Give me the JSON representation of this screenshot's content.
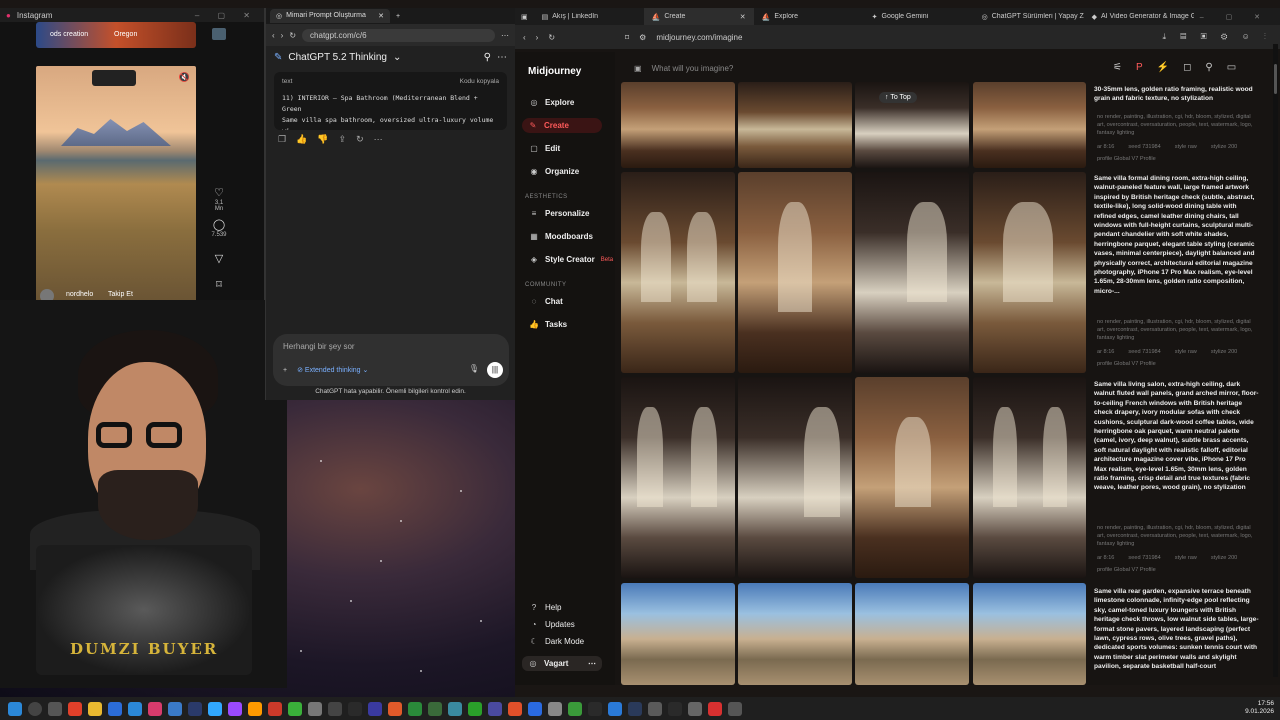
{
  "instagram": {
    "window_title": "Instagram",
    "banner_left": "ods creation",
    "banner_right": "Oregon",
    "handle": "nordhelo",
    "follow": "Takip Et",
    "likes": "3,1 Mn",
    "comments": "7.539"
  },
  "chatgpt": {
    "tab_title": "Mimari Prompt Oluşturma",
    "url": "chatgpt.com/c/6",
    "model": "ChatGPT 5.2 Thinking",
    "code_lang": "text",
    "copy_label": "Kodu kopyala",
    "code_line1": "11) INTERIOR — Spa Bathroom (Mediterranean Blend + Green",
    "code_line2": "Same villa spa bathroom, oversized ultra-luxury volume wi",
    "input_placeholder": "Herhangi bir şey sor",
    "thinking_label": "Extended thinking",
    "disclaimer": "ChatGPT hata yapabilir. Önemli bilgileri kontrol edin."
  },
  "browser": {
    "tabs": [
      {
        "label": "Akış | LinkedIn",
        "icon": "linkedin-icon"
      },
      {
        "label": "Create",
        "icon": "midjourney-icon"
      },
      {
        "label": "Explore",
        "icon": "midjourney-icon"
      },
      {
        "label": "Google Gemini",
        "icon": "gemini-icon"
      },
      {
        "label": "ChatGPT Sürümleri | Yapay Zeka",
        "icon": "chatgpt-icon"
      },
      {
        "label": "AI Video Generator & Image Ge",
        "icon": "ai-icon"
      }
    ],
    "url": "midjourney.com/imagine"
  },
  "midjourney": {
    "brand": "Midjourney",
    "search_placeholder": "What will you imagine?",
    "to_top": "↑ To Top",
    "nav": [
      {
        "label": "Explore",
        "icon": "compass-icon"
      },
      {
        "label": "Create",
        "icon": "brush-icon"
      },
      {
        "label": "Edit",
        "icon": "edit-icon"
      },
      {
        "label": "Organize",
        "icon": "folder-icon"
      }
    ],
    "aesthetics_header": "AESTHETICS",
    "aesthetics": [
      {
        "label": "Personalize"
      },
      {
        "label": "Moodboards"
      },
      {
        "label": "Style Creator",
        "badge": "Beta"
      }
    ],
    "community_header": "COMMUNITY",
    "community": [
      {
        "label": "Chat"
      },
      {
        "label": "Tasks"
      }
    ],
    "bottom": [
      {
        "label": "Help"
      },
      {
        "label": "Updates"
      },
      {
        "label": "Dark Mode"
      }
    ],
    "user": "Vagart",
    "prompts": [
      {
        "text": "30-35mm lens, golden ratio framing, realistic wood grain and fabric texture, no stylization",
        "negative": "no render, painting, illustration, cgi, hdr, bloom, stylized, digital art, overcontrast, oversaturation, people, text, watermark, logo, fantasy lighting",
        "ar": "ar 8:16",
        "seed": "seed 731984",
        "style": "style raw",
        "stylize": "stylize 200",
        "profile": "profile Global V7 Profile"
      },
      {
        "text": "Same villa formal dining room, extra-high ceiling, walnut-paneled feature wall, large framed artwork inspired by British heritage check (subtle, abstract, textile-like), long solid-wood dining table with refined edges, camel leather dining chairs, tall windows with full-height curtains, sculptural multi-pendant chandelier with soft white shades, herringbone parquet, elegant table styling (ceramic vases, minimal centerpiece), daylight balanced and physically correct, architectural editorial magazine photography, iPhone 17 Pro Max realism, eye-level 1.65m, 28-30mm lens, golden ratio composition, micro-...",
        "negative": "no render, painting, illustration, cgi, hdr, bloom, stylized, digital art, overcontrast, oversaturation, people, text, watermark, logo, fantasy lighting",
        "ar": "ar 8:16",
        "seed": "seed 731984",
        "style": "style raw",
        "stylize": "stylize 200",
        "profile": "profile Global V7 Profile"
      },
      {
        "text": "Same villa living salon, extra-high ceiling, dark walnut fluted wall panels, grand arched mirror, floor-to-ceiling French windows with British heritage check drapery, ivory modular sofas with check cushions, sculptural dark-wood coffee tables, wide herringbone oak parquet, warm neutral palette (camel, ivory, deep walnut), subtle brass accents, soft natural daylight with realistic falloff, editorial architecture magazine cover vibe, iPhone 17 Pro Max realism, eye-level 1.65m, 30mm lens, golden ratio framing, crisp detail and true textures (fabric weave, leather pores, wood grain), no stylization",
        "negative": "no render, painting, illustration, cgi, hdr, bloom, stylized, digital art, overcontrast, oversaturation, people, text, watermark, logo, fantasy lighting",
        "ar": "ar 8:16",
        "seed": "seed 731984",
        "style": "style raw",
        "stylize": "stylize 200",
        "profile": "profile Global V7 Profile"
      },
      {
        "text": "Same villa rear garden, expansive terrace beneath limestone colonnade, infinity-edge pool reflecting sky, camel-toned luxury loungers with British heritage check throws, low walnut side tables, large-format stone pavers, layered landscaping (perfect lawn, cypress rows, olive trees, gravel paths), dedicated sports volumes: sunken tennis court with warm timber slat perimeter walls and skylight pavilion, separate basketball half-court"
      }
    ]
  },
  "taskbar": {
    "time": "17:56",
    "date": "9.01.2026"
  },
  "overlay": {
    "logo_text": "DUMZI BUYER"
  }
}
